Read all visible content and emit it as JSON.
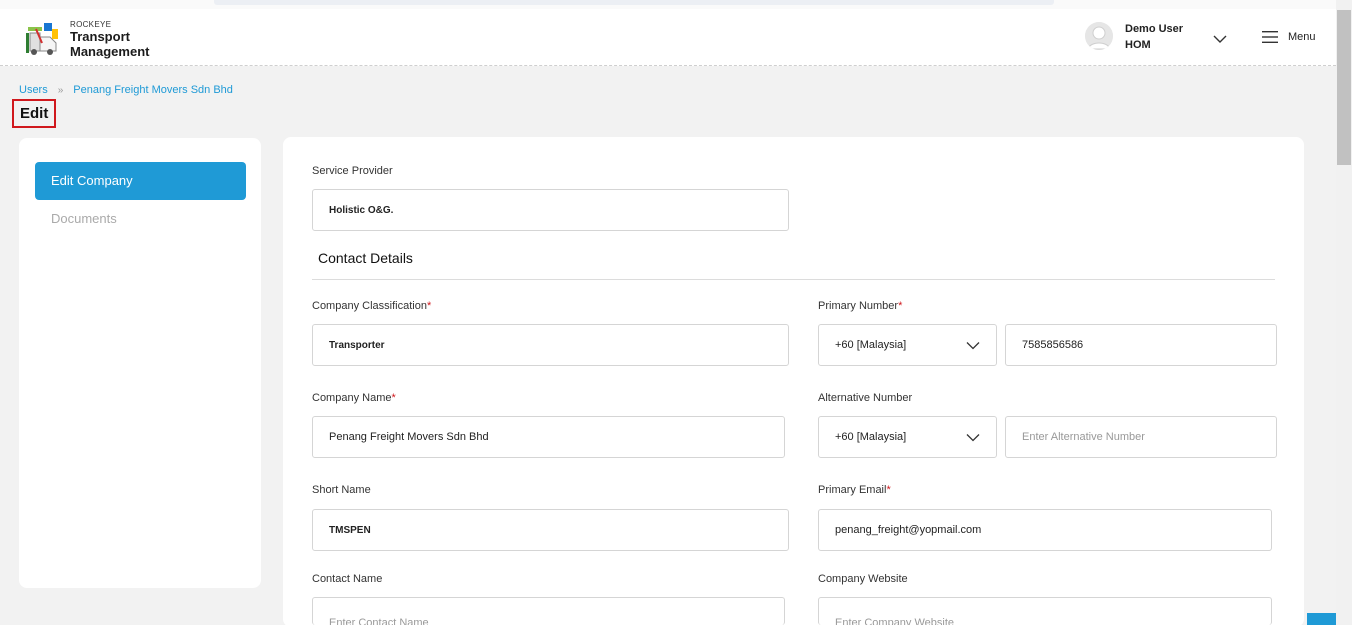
{
  "header": {
    "brand_small": "ROCKEYE",
    "brand_line1": "Transport",
    "brand_line2": "Management",
    "user_name": "Demo User",
    "user_org": "HOM",
    "menu_label": "Menu"
  },
  "breadcrumb": {
    "items": [
      "Users",
      "Penang Freight Movers Sdn Bhd"
    ],
    "separator": "»"
  },
  "page_title": "Edit",
  "sidebar": {
    "items": [
      {
        "label": "Edit Company",
        "active": true
      },
      {
        "label": "Documents",
        "active": false
      }
    ]
  },
  "form": {
    "service_provider": {
      "label": "Service Provider",
      "value": "Holistic O&G."
    },
    "section_title": "Contact Details",
    "company_classification": {
      "label": "Company Classification",
      "required": "*",
      "value": "Transporter"
    },
    "primary_number": {
      "label": "Primary Number",
      "required": "*",
      "country": "+60 [Malaysia]",
      "value": "7585856586"
    },
    "company_name": {
      "label": "Company Name",
      "required": "*",
      "value": "Penang Freight Movers Sdn Bhd"
    },
    "alternative_number": {
      "label": "Alternative Number",
      "country": "+60 [Malaysia]",
      "placeholder": "Enter Alternative Number"
    },
    "short_name": {
      "label": "Short Name",
      "value": "TMSPEN"
    },
    "primary_email": {
      "label": "Primary Email",
      "required": "*",
      "value": "penang_freight@yopmail.com"
    },
    "contact_name": {
      "label": "Contact Name",
      "placeholder": "Enter Contact Name"
    },
    "company_website": {
      "label": "Company Website",
      "placeholder": "Enter Company Website"
    }
  },
  "colors": {
    "accent": "#1f9ad6",
    "required": "#d0181d",
    "title_highlight": "#d0181d"
  }
}
